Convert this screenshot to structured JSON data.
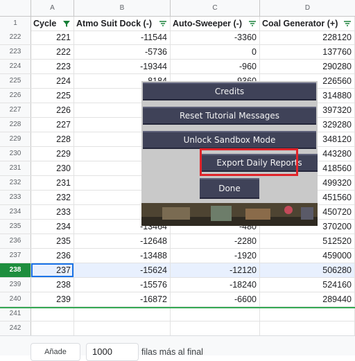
{
  "columns": {
    "a": "A",
    "b": "B",
    "c": "C",
    "d": "D"
  },
  "header_row": {
    "num": "1",
    "cycle": "Cycle",
    "atmo": "Atmo Suit Dock (-)",
    "sweeper": "Auto-Sweeper (-)",
    "coal": "Coal Generator (+)"
  },
  "rows": [
    {
      "num": "222",
      "cycle": "221",
      "atmo": "-11544",
      "sweeper": "-3360",
      "coal": "228120"
    },
    {
      "num": "223",
      "cycle": "222",
      "atmo": "-5736",
      "sweeper": "0",
      "coal": "137760"
    },
    {
      "num": "224",
      "cycle": "223",
      "atmo": "-19344",
      "sweeper": "-960",
      "coal": "290280"
    },
    {
      "num": "225",
      "cycle": "224",
      "atmo": "-8184",
      "sweeper": "-9360",
      "coal": "226560"
    },
    {
      "num": "226",
      "cycle": "225",
      "atmo": "",
      "sweeper": "",
      "coal": "314880"
    },
    {
      "num": "227",
      "cycle": "226",
      "atmo": "",
      "sweeper": "",
      "coal": "397320"
    },
    {
      "num": "228",
      "cycle": "227",
      "atmo": "",
      "sweeper": "",
      "coal": "329280"
    },
    {
      "num": "229",
      "cycle": "228",
      "atmo": "",
      "sweeper": "",
      "coal": "348120"
    },
    {
      "num": "230",
      "cycle": "229",
      "atmo": "",
      "sweeper": "",
      "coal": "443280"
    },
    {
      "num": "231",
      "cycle": "230",
      "atmo": "",
      "sweeper": "",
      "coal": "418560"
    },
    {
      "num": "232",
      "cycle": "231",
      "atmo": "",
      "sweeper": "",
      "coal": "499320"
    },
    {
      "num": "233",
      "cycle": "232",
      "atmo": "",
      "sweeper": "",
      "coal": "451560"
    },
    {
      "num": "234",
      "cycle": "233",
      "atmo": "",
      "sweeper": "",
      "coal": "450720"
    },
    {
      "num": "235",
      "cycle": "234",
      "atmo": "-13464",
      "sweeper": "-480",
      "coal": "370200"
    },
    {
      "num": "236",
      "cycle": "235",
      "atmo": "-12648",
      "sweeper": "-2280",
      "coal": "512520"
    },
    {
      "num": "237",
      "cycle": "236",
      "atmo": "-13488",
      "sweeper": "-1920",
      "coal": "459000"
    },
    {
      "num": "238",
      "cycle": "237",
      "atmo": "-15624",
      "sweeper": "-12120",
      "coal": "506280"
    },
    {
      "num": "239",
      "cycle": "238",
      "atmo": "-15576",
      "sweeper": "-18240",
      "coal": "524160"
    },
    {
      "num": "240",
      "cycle": "239",
      "atmo": "-16872",
      "sweeper": "-6600",
      "coal": "289440"
    },
    {
      "num": "241",
      "cycle": "",
      "atmo": "",
      "sweeper": "",
      "coal": ""
    },
    {
      "num": "242",
      "cycle": "",
      "atmo": "",
      "sweeper": "",
      "coal": ""
    }
  ],
  "menu": {
    "credits": "Credits",
    "reset": "Reset Tutorial Messages",
    "sandbox": "Unlock Sandbox Mode",
    "export": "Export Daily Reports",
    "done": "Done"
  },
  "footer": {
    "add_label": "Añade",
    "count": "1000",
    "suffix": "filas más al final"
  },
  "colors": {
    "highlight": "#e0242a",
    "button": "#3f4258",
    "selected_row": "#1e8e3e"
  }
}
